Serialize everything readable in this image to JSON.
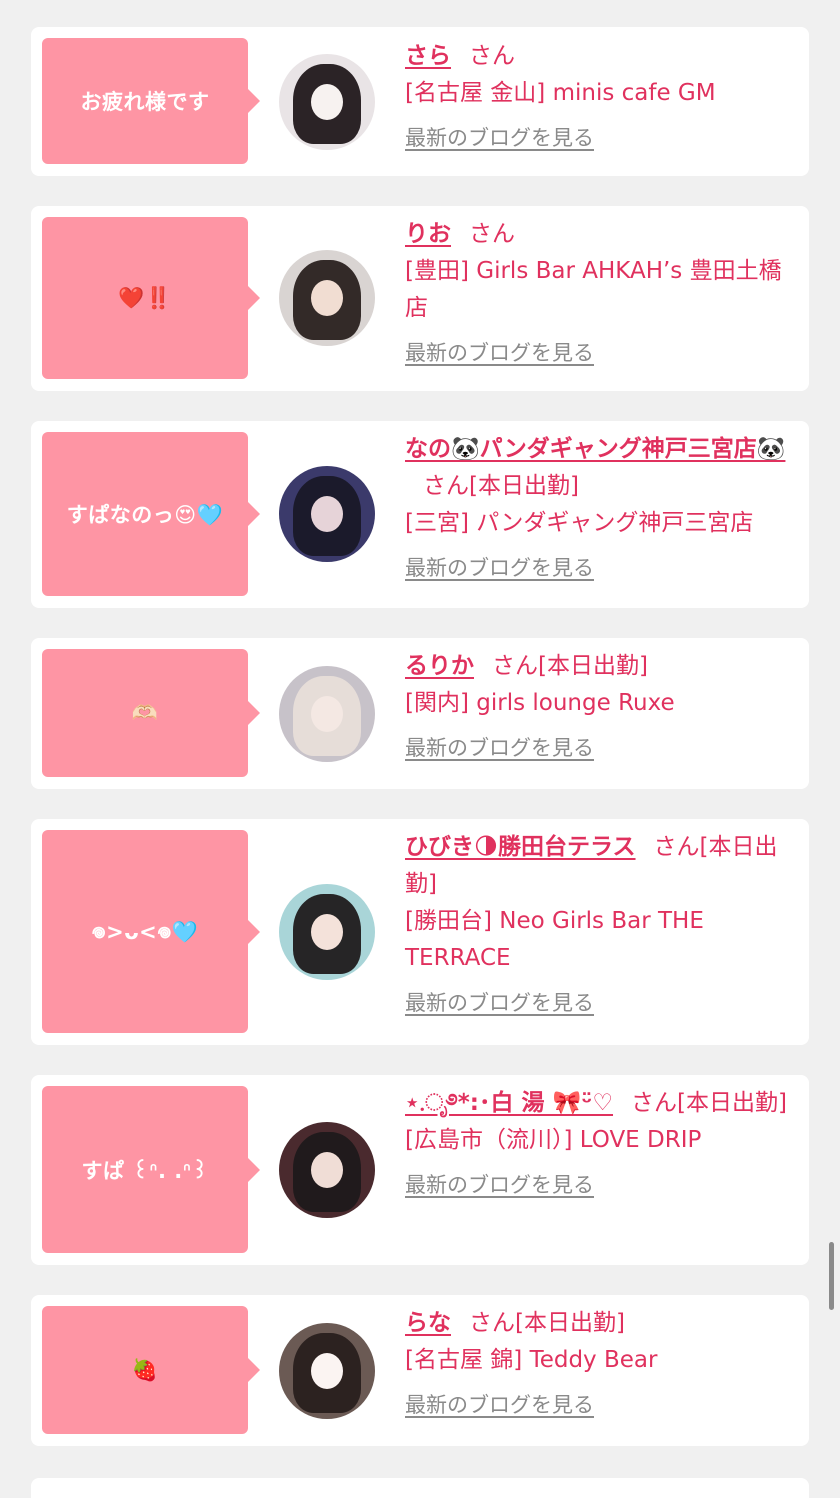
{
  "cards": [
    {
      "bubble": "お疲れ様です",
      "name": "さら",
      "san": "さん",
      "shop": "[名古屋 金山] minis cafe GM",
      "blog": "最新のブログを見る"
    },
    {
      "bubble": "❤️‼️",
      "name": "りお",
      "san": "さん",
      "shop": "[豊田] Girls Bar AHKAH’s 豊田土橋店",
      "blog": "最新のブログを見る"
    },
    {
      "bubble": "すぱなのっ😍🩵",
      "name": "なの🐼パンダギャング神戸三宮店🐼",
      "san": "さん[本日出勤]",
      "shop": "[三宮] パンダギャング神戸三宮店",
      "blog": "最新のブログを見る"
    },
    {
      "bubble": "🫶🏻",
      "name": "るりか",
      "san": "さん[本日出勤]",
      "shop": "[関内] girls lounge Ruxe",
      "blog": "最新のブログを見る"
    },
    {
      "bubble": "𖦹>ᴗ<𖦹🩵",
      "name": "ひびき🌗勝田台テラス",
      "san": "さん[本日出勤]",
      "shop": "[勝田台] Neo Girls Bar THE TERRACE",
      "blog": "最新のブログを見る"
    },
    {
      "bubble": "すぱ ꒰ᐢ. .ᐢ꒱",
      "name": "⋆.ೃ࿔*:･白 湯 🎀ᵕ̈♡",
      "san": "さん[本日出勤]",
      "shop": "[広島市（流川）] LOVE DRIP",
      "blog": "最新のブログを見る"
    },
    {
      "bubble": "🍓",
      "name": "らな",
      "san": "さん[本日出勤]",
      "shop": "[名古屋 錦] Teddy Bear",
      "blog": "最新のブログを見る"
    }
  ],
  "colors": {
    "bubble": "#fe95a4",
    "accent": "#e0315e",
    "link_gray": "#8a8a8a",
    "background": "#f0f0f0"
  }
}
